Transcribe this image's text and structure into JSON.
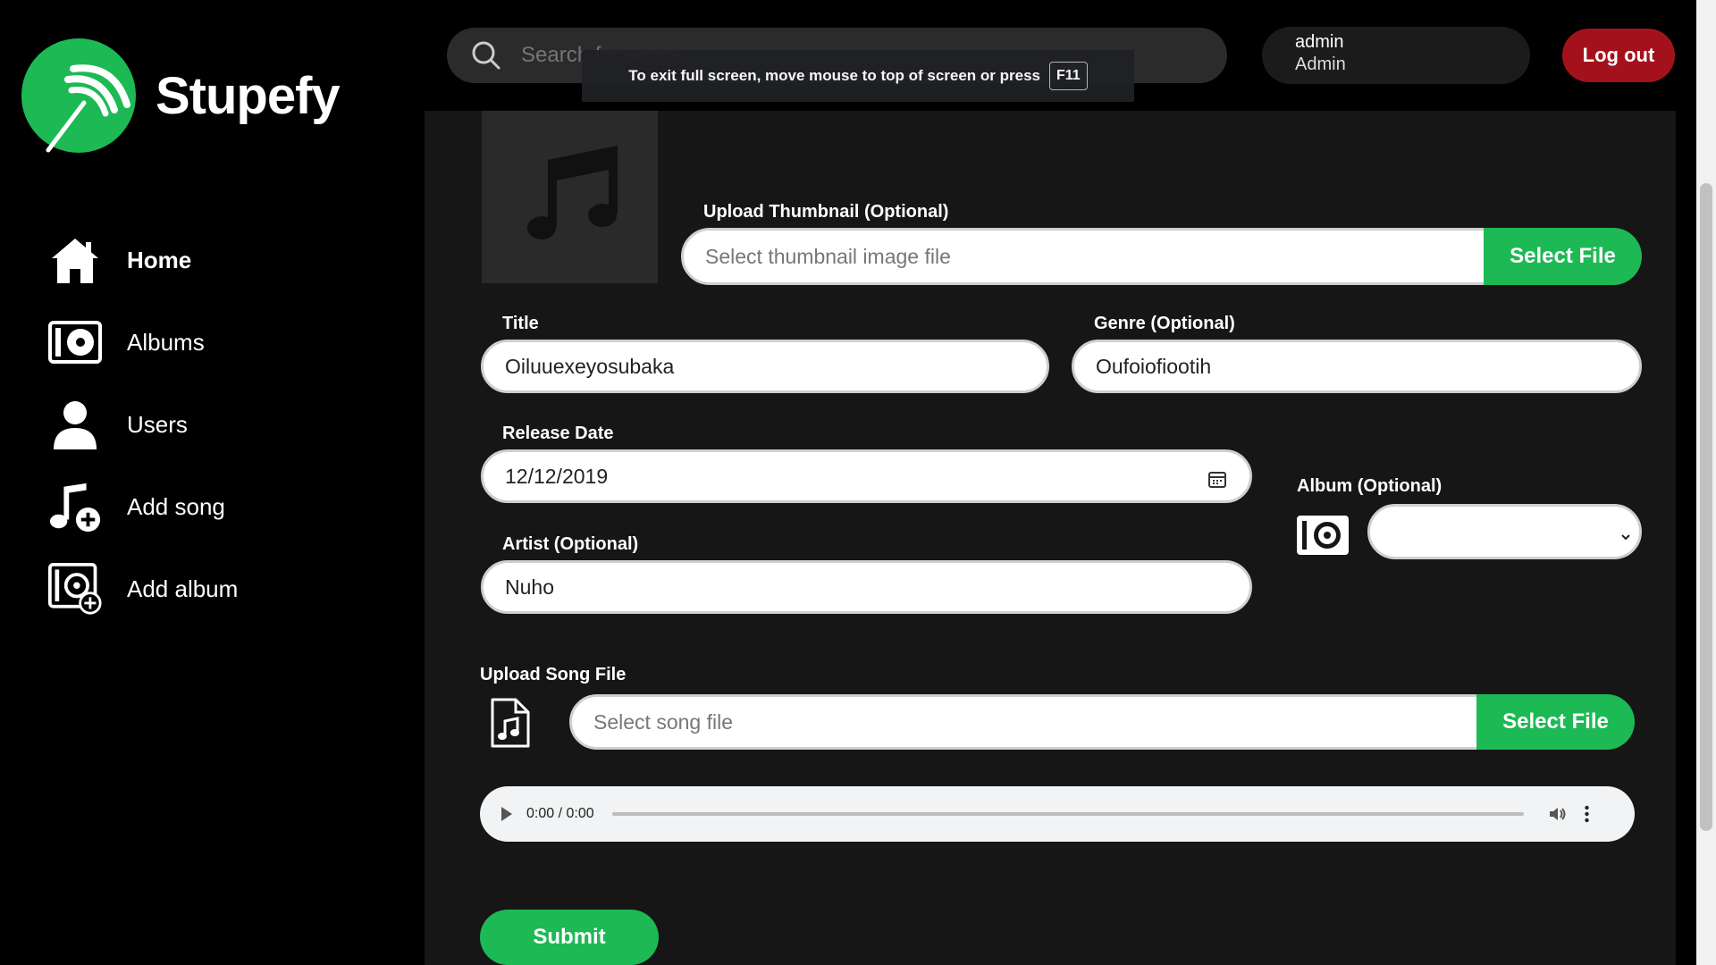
{
  "app": {
    "name": "Stupefy"
  },
  "sidebar": {
    "items": [
      {
        "label": "Home",
        "icon": "home-icon"
      },
      {
        "label": "Albums",
        "icon": "album-icon"
      },
      {
        "label": "Users",
        "icon": "user-icon"
      },
      {
        "label": "Add song",
        "icon": "add-song-icon"
      },
      {
        "label": "Add album",
        "icon": "add-album-icon"
      }
    ]
  },
  "header": {
    "search_placeholder": "Search for songs...",
    "user": {
      "username": "admin",
      "role": "Admin"
    },
    "logout_label": "Log out"
  },
  "fullscreen_notice": {
    "text": "To exit full screen, move mouse to top of screen or press",
    "key": "F11"
  },
  "form": {
    "thumbnail": {
      "label": "Upload Thumbnail (Optional)",
      "placeholder": "Select thumbnail image file",
      "button": "Select File"
    },
    "title": {
      "label": "Title",
      "value": "Oiluuexeyosubaka"
    },
    "genre": {
      "label": "Genre (Optional)",
      "value": "Oufoiofiootih"
    },
    "release_date": {
      "label": "Release Date",
      "value": "12/12/2019"
    },
    "album": {
      "label": "Album (Optional)",
      "value": ""
    },
    "artist": {
      "label": "Artist (Optional)",
      "value": "Nuho"
    },
    "song_file": {
      "label": "Upload Song File",
      "placeholder": "Select song file",
      "button": "Select File"
    },
    "audio": {
      "time": "0:00 / 0:00"
    },
    "submit_label": "Submit"
  },
  "colors": {
    "accent": "#1db954",
    "logout": "#a3121c",
    "panel": "#161616"
  }
}
